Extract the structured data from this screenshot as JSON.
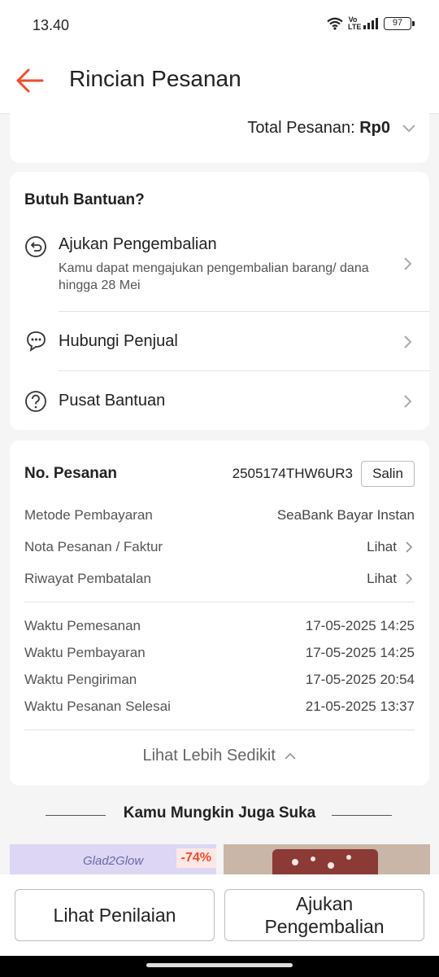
{
  "status_bar": {
    "time": "13.40",
    "network": "Vo LTE",
    "battery": "97"
  },
  "header": {
    "title": "Rincian Pesanan"
  },
  "order_total": {
    "label": "Total Pesanan:",
    "value": "Rp0"
  },
  "help": {
    "title": "Butuh Bantuan?",
    "items": [
      {
        "label": "Ajukan Pengembalian",
        "description": "Kamu dapat mengajukan pengembalian barang/ dana hingga 28 Mei",
        "icon": "return-icon"
      },
      {
        "label": "Hubungi Penjual",
        "icon": "chat-icon"
      },
      {
        "label": "Pusat Bantuan",
        "icon": "help-icon"
      }
    ]
  },
  "order": {
    "no_label": "No. Pesanan",
    "no_value": "2505174THW6UR3",
    "copy_label": "Salin",
    "payment_label": "Metode Pembayaran",
    "payment_value": "SeaBank Bayar Instan",
    "invoice_label": "Nota Pesanan / Faktur",
    "invoice_value": "Lihat",
    "cancel_history_label": "Riwayat Pembatalan",
    "cancel_history_value": "Lihat",
    "times": [
      {
        "label": "Waktu Pemesanan",
        "value": "17-05-2025 14:25"
      },
      {
        "label": "Waktu Pembayaran",
        "value": "17-05-2025 14:25"
      },
      {
        "label": "Waktu Pengiriman",
        "value": "17-05-2025 20:54"
      },
      {
        "label": "Waktu Pesanan Selesai",
        "value": "21-05-2025 13:37"
      }
    ],
    "see_less": "Lihat Lebih Sedikit"
  },
  "recommendations": {
    "title": "Kamu Mungkin Juga Suka",
    "products": [
      {
        "brand": "Glad2Glow",
        "discount": "-74%"
      }
    ]
  },
  "actions": {
    "review": "Lihat Penilaian",
    "return": "Ajukan Pengembalian"
  },
  "colors": {
    "accent": "#ee4d2d",
    "background": "#f5f5f5",
    "card": "#ffffff"
  }
}
